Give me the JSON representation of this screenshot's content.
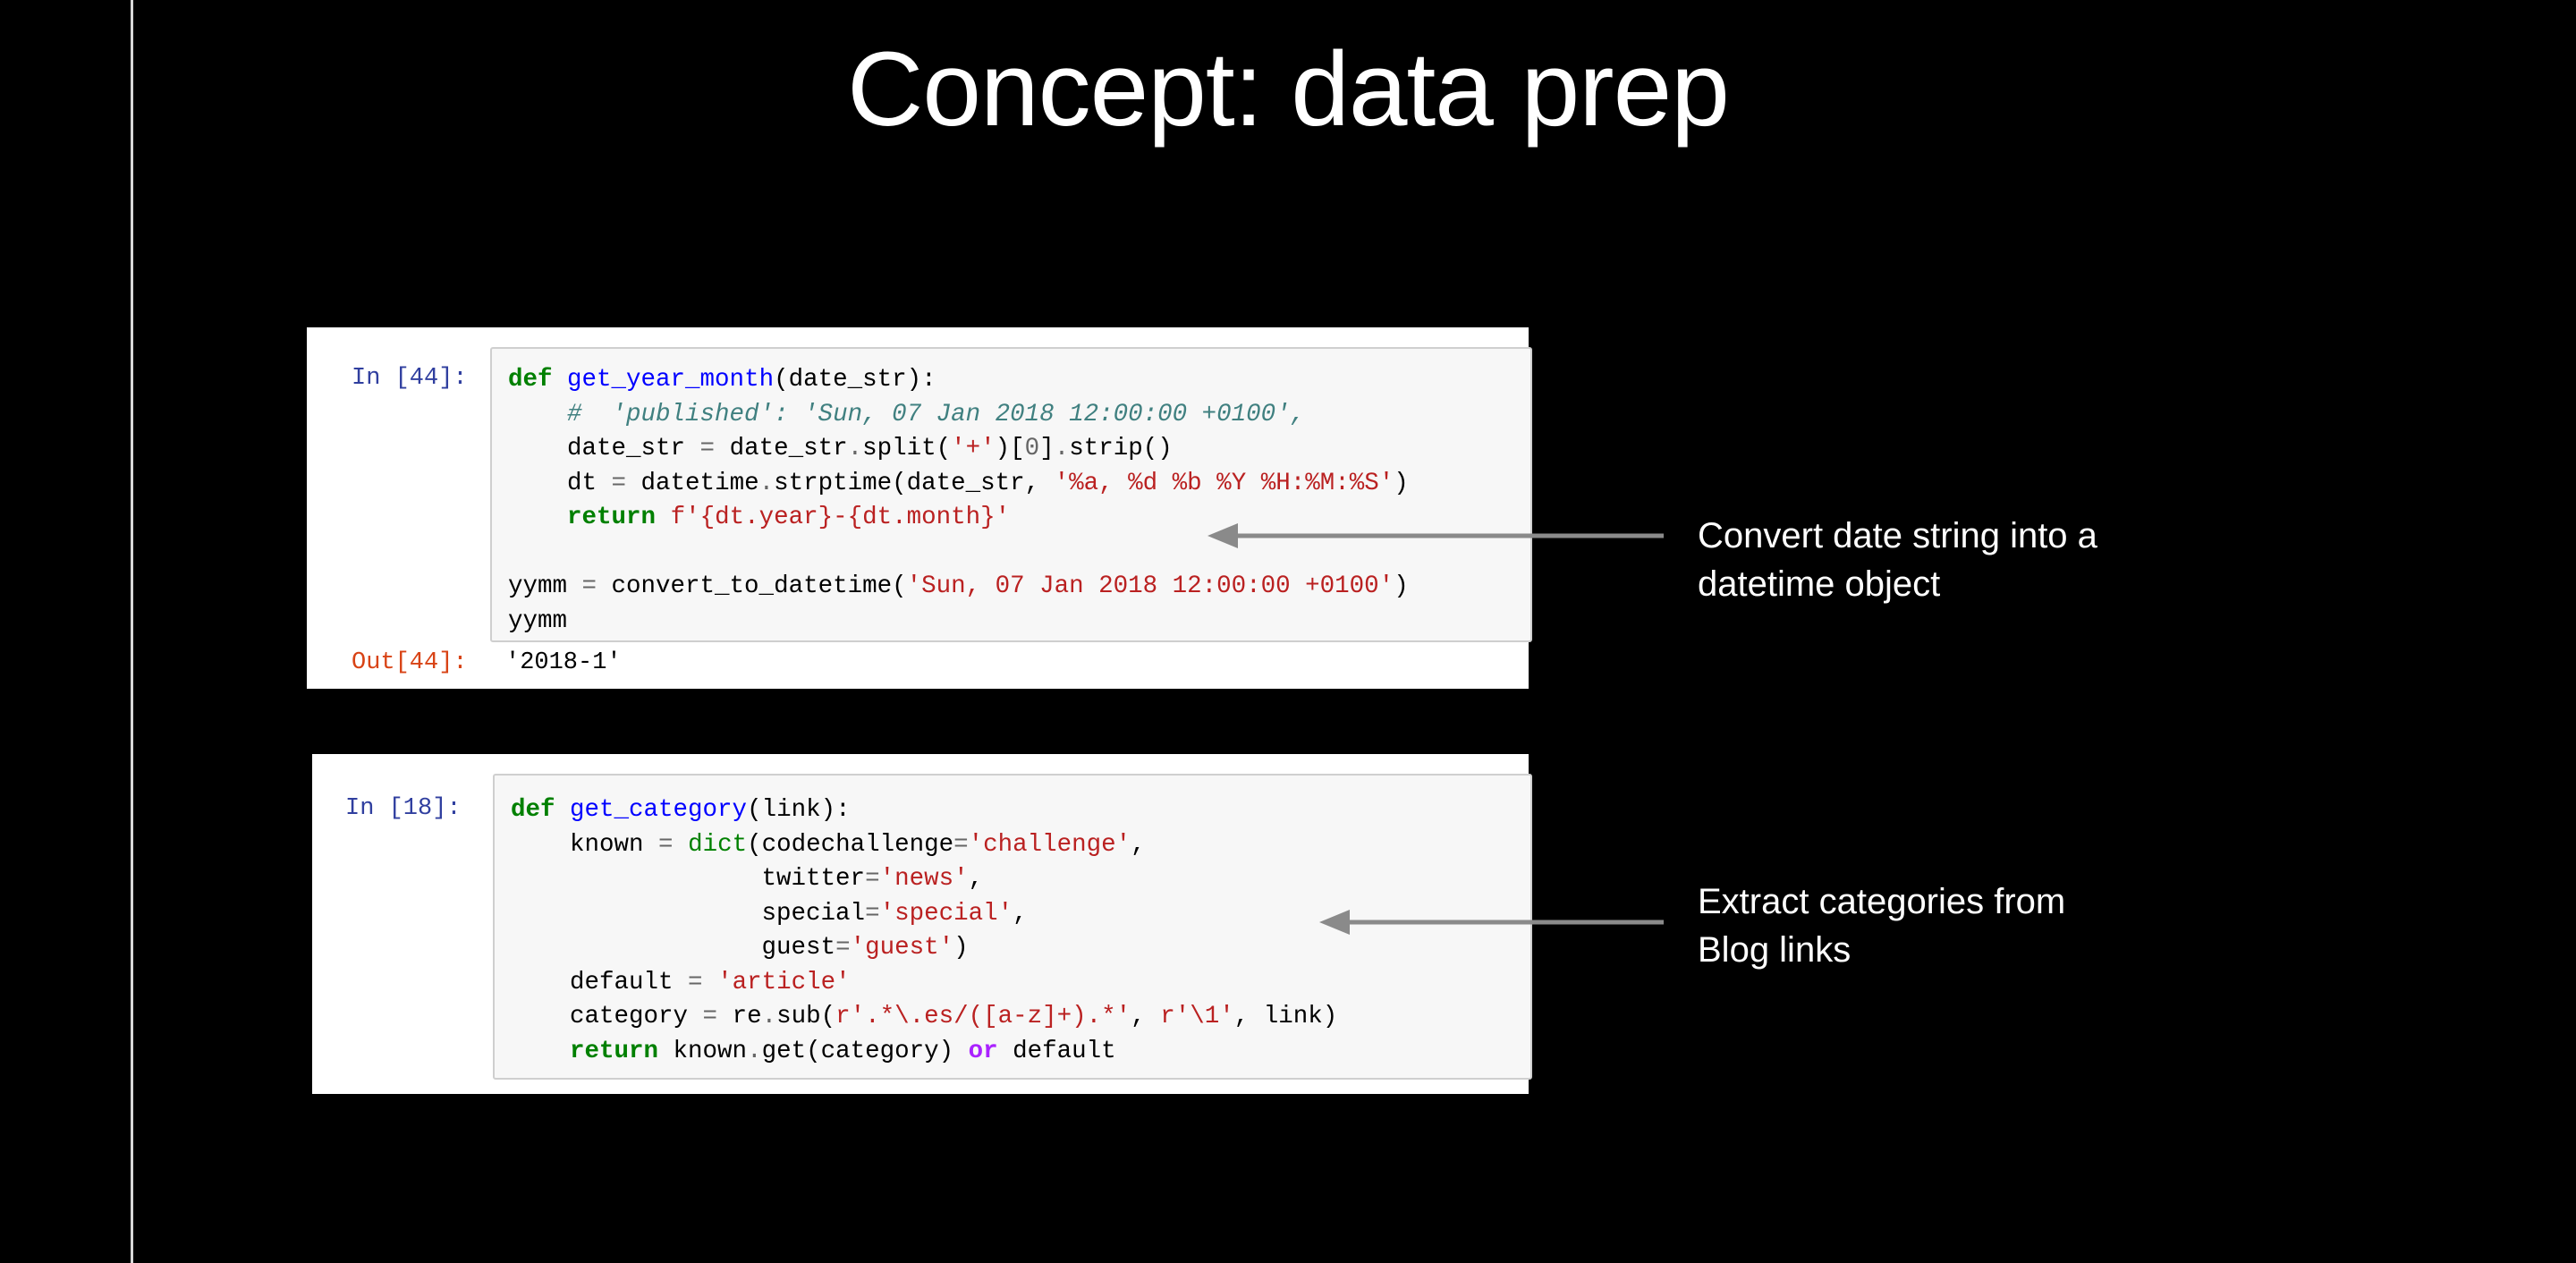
{
  "slide": {
    "title": "Concept: data prep"
  },
  "cell1": {
    "in_prompt": "In [44]:",
    "out_prompt": "Out[44]:",
    "output": "'2018-1'",
    "lines": [
      [
        [
          "kw",
          "def"
        ],
        [
          "t",
          " "
        ],
        [
          "fn",
          "get_year_month"
        ],
        [
          "t",
          "(date_str):"
        ]
      ],
      [
        [
          "t",
          "    "
        ],
        [
          "cm",
          "#  'published': 'Sun, 07 Jan 2018 12:00:00 +0100',"
        ]
      ],
      [
        [
          "t",
          "    date_str "
        ],
        [
          "op",
          "="
        ],
        [
          "t",
          " date_str"
        ],
        [
          "op",
          "."
        ],
        [
          "t",
          "split("
        ],
        [
          "st",
          "'+'"
        ],
        [
          "t",
          ")["
        ],
        [
          "num",
          "0"
        ],
        [
          "t",
          "]"
        ],
        [
          "op",
          "."
        ],
        [
          "t",
          "strip()"
        ]
      ],
      [
        [
          "t",
          "    dt "
        ],
        [
          "op",
          "="
        ],
        [
          "t",
          " datetime"
        ],
        [
          "op",
          "."
        ],
        [
          "t",
          "strptime(date_str, "
        ],
        [
          "st",
          "'%a, %d %b %Y %H:%M:%S'"
        ],
        [
          "t",
          ")"
        ]
      ],
      [
        [
          "t",
          "    "
        ],
        [
          "kw",
          "return"
        ],
        [
          "t",
          " "
        ],
        [
          "st",
          "f'{dt.year}-{dt.month}'"
        ]
      ],
      [
        [
          "t",
          ""
        ]
      ],
      [
        [
          "t",
          "yymm "
        ],
        [
          "op",
          "="
        ],
        [
          "t",
          " convert_to_datetime("
        ],
        [
          "st",
          "'Sun, 07 Jan 2018 12:00:00 +0100'"
        ],
        [
          "t",
          ")"
        ]
      ],
      [
        [
          "t",
          "yymm"
        ]
      ]
    ]
  },
  "cell2": {
    "in_prompt": "In [18]:",
    "lines": [
      [
        [
          "kw",
          "def"
        ],
        [
          "t",
          " "
        ],
        [
          "fn",
          "get_category"
        ],
        [
          "t",
          "(link):"
        ]
      ],
      [
        [
          "t",
          "    known "
        ],
        [
          "op",
          "="
        ],
        [
          "t",
          " "
        ],
        [
          "bi",
          "dict"
        ],
        [
          "t",
          "(codechallenge"
        ],
        [
          "op",
          "="
        ],
        [
          "st",
          "'challenge'"
        ],
        [
          "t",
          ","
        ]
      ],
      [
        [
          "t",
          "                 twitter"
        ],
        [
          "op",
          "="
        ],
        [
          "st",
          "'news'"
        ],
        [
          "t",
          ","
        ]
      ],
      [
        [
          "t",
          "                 special"
        ],
        [
          "op",
          "="
        ],
        [
          "st",
          "'special'"
        ],
        [
          "t",
          ","
        ]
      ],
      [
        [
          "t",
          "                 guest"
        ],
        [
          "op",
          "="
        ],
        [
          "st",
          "'guest'"
        ],
        [
          "t",
          ")"
        ]
      ],
      [
        [
          "t",
          "    default "
        ],
        [
          "op",
          "="
        ],
        [
          "t",
          " "
        ],
        [
          "st",
          "'article'"
        ]
      ],
      [
        [
          "t",
          "    category "
        ],
        [
          "op",
          "="
        ],
        [
          "t",
          " re"
        ],
        [
          "op",
          "."
        ],
        [
          "t",
          "sub("
        ],
        [
          "st",
          "r'.*\\.es/([a-z]+).*'"
        ],
        [
          "t",
          ", "
        ],
        [
          "st",
          "r'\\1'"
        ],
        [
          "t",
          ", link)"
        ]
      ],
      [
        [
          "t",
          "    "
        ],
        [
          "kw",
          "return"
        ],
        [
          "t",
          " known"
        ],
        [
          "op",
          "."
        ],
        [
          "t",
          "get(category) "
        ],
        [
          "ow",
          "or"
        ],
        [
          "t",
          " default"
        ]
      ]
    ]
  },
  "annotations": {
    "first": [
      "Convert date string into a",
      "datetime object"
    ],
    "second": [
      "Extract categories from",
      "Blog links"
    ]
  },
  "colors": {
    "background": "#000000",
    "arrow": "#8a8a8a",
    "text": "#ffffff"
  }
}
